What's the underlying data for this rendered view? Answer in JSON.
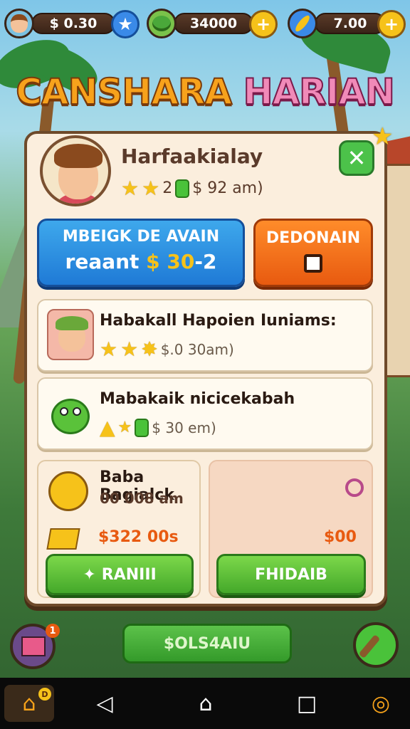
{
  "hud": {
    "resource_1": {
      "value": "$ 0.30",
      "icon": "player-avatar-icon",
      "plus_icon": "star-icon"
    },
    "resource_2": {
      "value": "34000",
      "icon": "monster-icon",
      "plus_icon": "coin-plus-icon"
    },
    "resource_3": {
      "value": "7.00",
      "icon": "feather-icon",
      "plus_icon": "plus-icon"
    }
  },
  "title": {
    "part1": "CANSHARA",
    "part2": "HARIAN"
  },
  "profile": {
    "name": "Harfaakialay",
    "stats": "2",
    "amount": "$ 92 am)"
  },
  "buttons": {
    "blue_line1": "MBEIGK DE AVAIN",
    "blue_line2_prefix": "reaant ",
    "blue_line2_coin": "$ 30",
    "blue_line2_suffix": "-2",
    "orange_label": "DEDONAIN"
  },
  "cards": [
    {
      "title": "Habakall Hapoien Iuniams:",
      "amount": "$.0 30am)"
    },
    {
      "title": "Mabakaik nicicekabah",
      "amount": "$ 30 em)"
    }
  ],
  "reward_box": {
    "title": "Baba Bagialck",
    "sub": "00 008 am",
    "price": "$322 00s",
    "button": "RANIII"
  },
  "reward_box_right": {
    "price": "$00",
    "button": "FHIDAIB"
  },
  "bottom": {
    "main_button": "$OLS4AIU",
    "badge_left": "1"
  },
  "navbar": {
    "home_badge": "D"
  },
  "colors": {
    "accent_orange": "#f7a21c",
    "accent_pink": "#f08ab8",
    "button_blue": "#1f7ad6",
    "button_orange": "#e85a10",
    "button_green": "#44a82a",
    "panel_bg": "#fbeedd"
  }
}
